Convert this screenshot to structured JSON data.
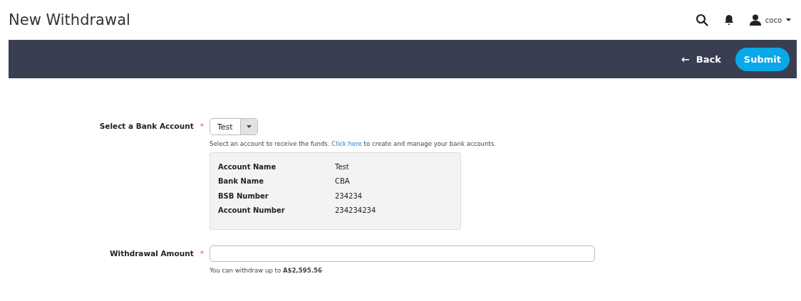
{
  "page": {
    "title": "New Withdrawal"
  },
  "header": {
    "user": "coco"
  },
  "toolbar": {
    "back": "Back",
    "arrow": "←",
    "submit": "Submit"
  },
  "bank_account": {
    "label": "Select a Bank Account",
    "required": "*",
    "value": "Test",
    "hint": {
      "before": "Select an account to receive the funds.",
      "link": "Click here",
      "after": "to create and manage your bank accounts."
    },
    "details": [
      {
        "label": "Account Name",
        "value": "Test"
      },
      {
        "label": "Bank Name",
        "value": "CBA"
      },
      {
        "label": "BSB Number",
        "value": "234234"
      },
      {
        "label": "Account Number",
        "value": "234234234"
      }
    ]
  },
  "amount": {
    "label": "Withdrawal Amount",
    "required": "*",
    "hint": "You can withdraw up to **A$2,595.56**"
  }
}
